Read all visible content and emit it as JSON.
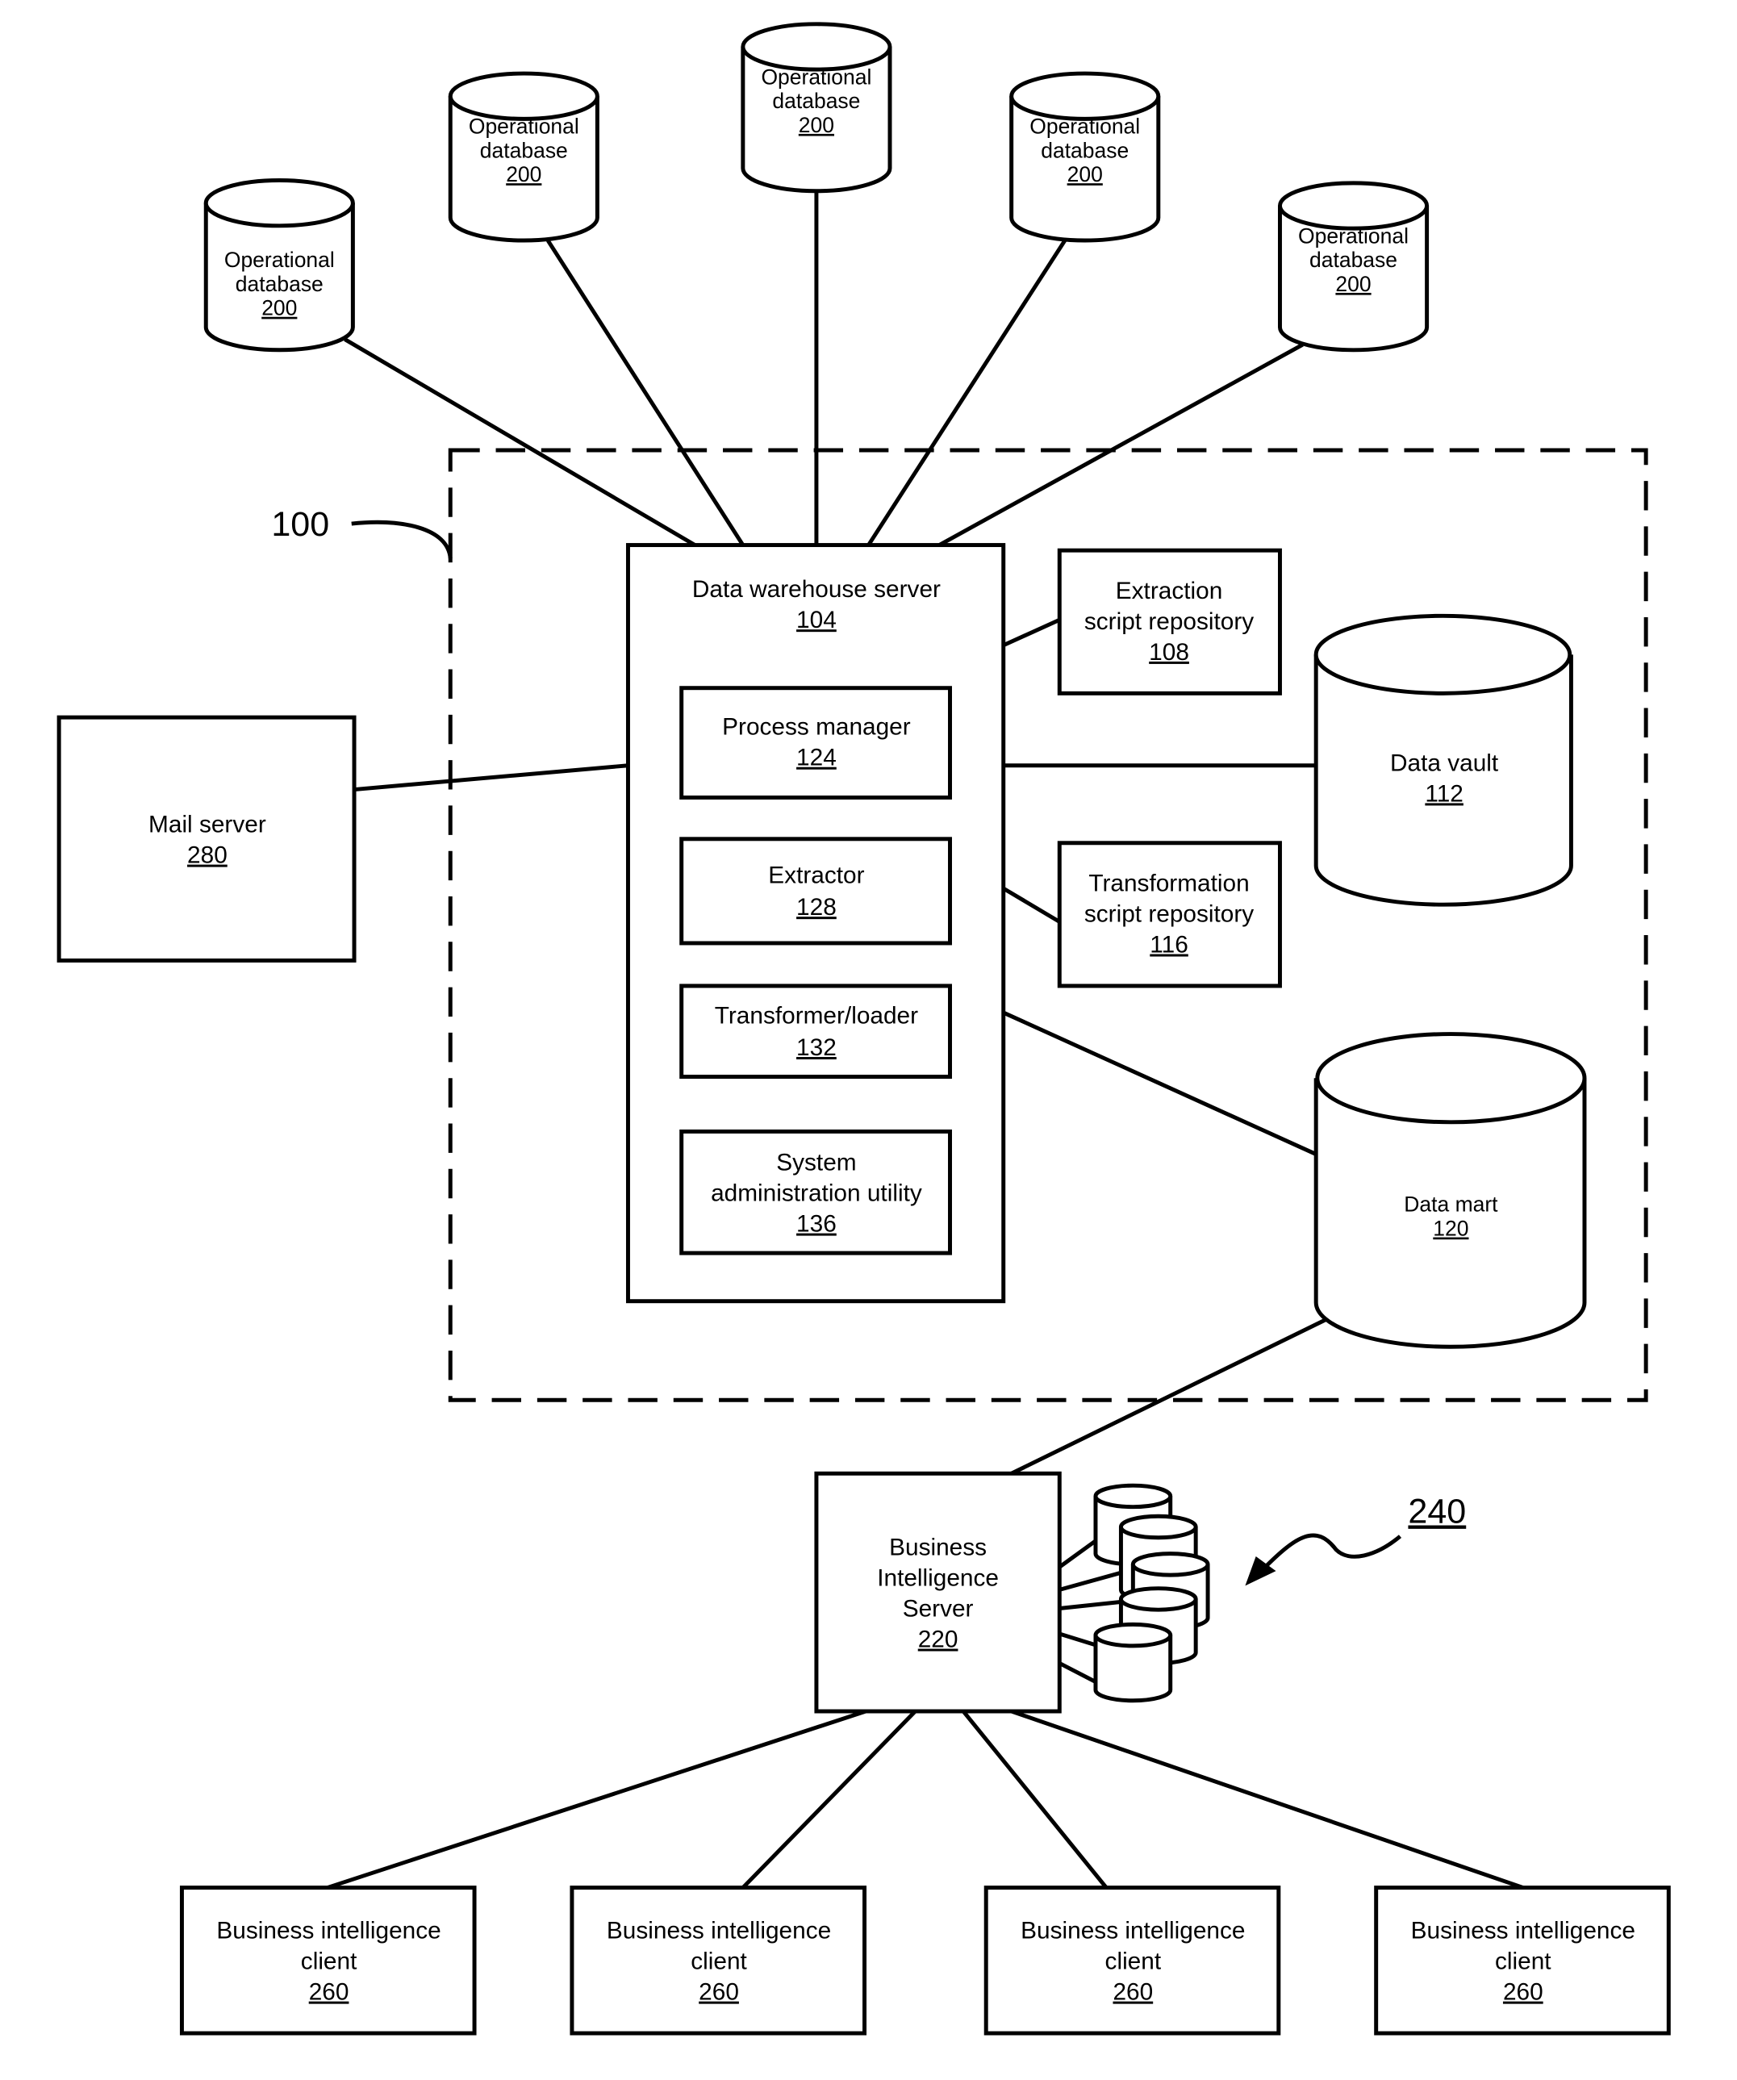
{
  "figure": {
    "system_ref": "100",
    "bi_databases_ref": "240",
    "operational_databases": [
      {
        "label": "Operational database",
        "ref": "200"
      },
      {
        "label": "Operational database",
        "ref": "200"
      },
      {
        "label": "Operational database",
        "ref": "200"
      },
      {
        "label": "Operational database",
        "ref": "200"
      },
      {
        "label": "Operational database",
        "ref": "200"
      }
    ],
    "data_warehouse_server": {
      "label": "Data warehouse server",
      "ref": "104"
    },
    "components": [
      {
        "label": "Process manager",
        "ref": "124"
      },
      {
        "label": "Extractor",
        "ref": "128"
      },
      {
        "label": "Transformer/loader",
        "ref": "132"
      },
      {
        "label_line1": "System",
        "label_line2": "administration utility",
        "ref": "136"
      }
    ],
    "extraction_repo": {
      "line1": "Extraction",
      "line2": "script repository",
      "ref": "108"
    },
    "transformation_repo": {
      "line1": "Transformation",
      "line2": "script repository",
      "ref": "116"
    },
    "data_vault": {
      "label": "Data vault",
      "ref": "112"
    },
    "data_mart": {
      "label": "Data mart",
      "ref": "120"
    },
    "mail_server": {
      "label": "Mail server",
      "ref": "280"
    },
    "bi_server": {
      "line1": "Business",
      "line2": "Intelligence",
      "line3": "Server",
      "ref": "220"
    },
    "bi_clients": [
      {
        "line1": "Business intelligence",
        "line2": "client",
        "ref": "260"
      },
      {
        "line1": "Business intelligence",
        "line2": "client",
        "ref": "260"
      },
      {
        "line1": "Business intelligence",
        "line2": "client",
        "ref": "260"
      },
      {
        "line1": "Business intelligence",
        "line2": "client",
        "ref": "260"
      }
    ]
  }
}
